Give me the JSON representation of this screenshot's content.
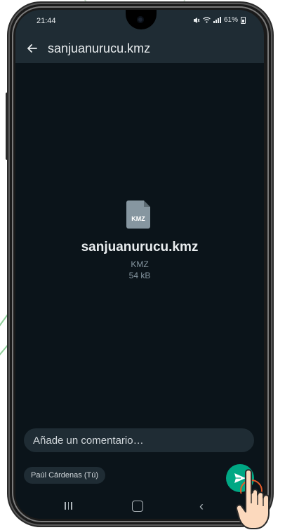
{
  "status_bar": {
    "time": "21:44",
    "battery": "61%"
  },
  "app_bar": {
    "back_icon": "arrow-left-icon",
    "title": "sanjuanurucu.kmz"
  },
  "file_preview": {
    "icon_label": "KMZ",
    "file_name": "sanjuanurucu.kmz",
    "file_type": "KMZ",
    "file_size": "54 kB"
  },
  "composer": {
    "comment_placeholder": "Añade un comentario…",
    "recipient": "Paúl Cárdenas (Tú)",
    "send_icon": "send-icon"
  },
  "nav_bar": {
    "recents_icon": "recents-icon",
    "home_icon": "home-icon",
    "back_icon": "chevron-left-icon"
  },
  "colors": {
    "screen_bg": "#0b141a",
    "bar_bg": "#1f2c34",
    "accent": "#00a884",
    "text_primary": "#e9edef",
    "text_secondary": "#8696a0",
    "tap_highlight": "#e35b2a"
  }
}
